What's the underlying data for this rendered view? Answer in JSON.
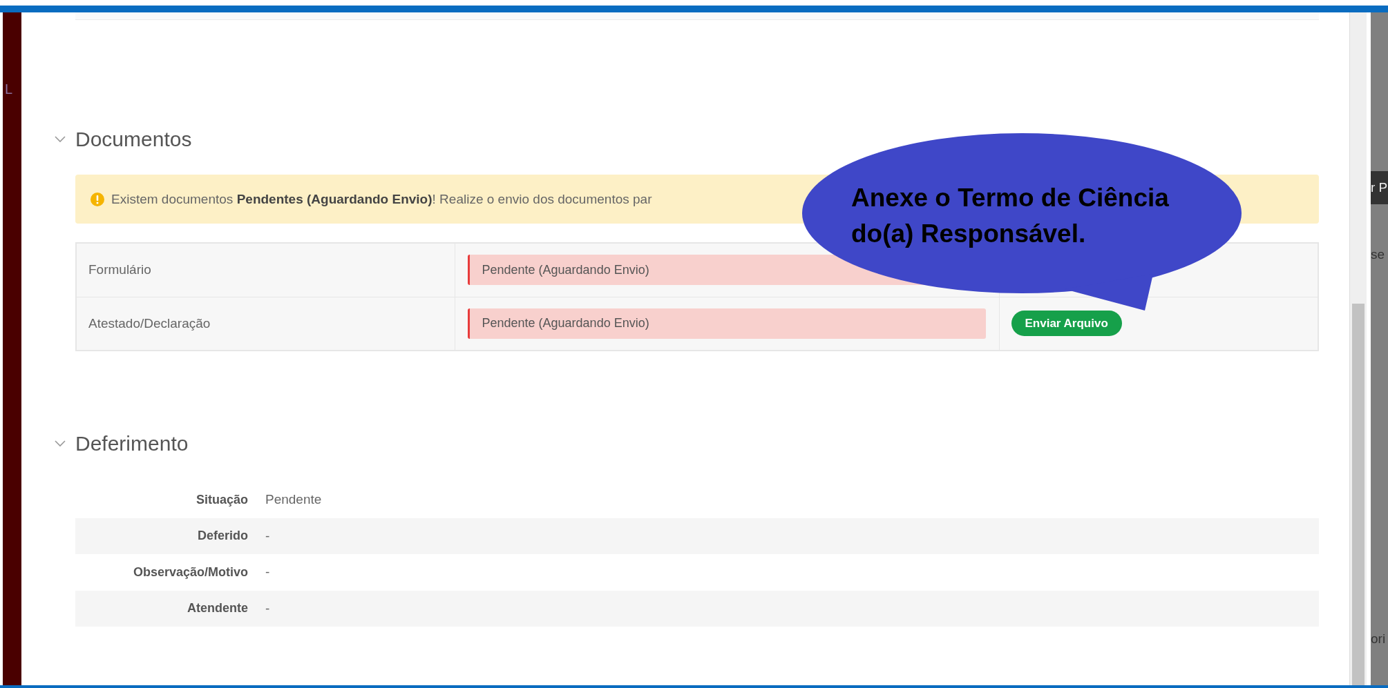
{
  "left_strip": {
    "label": "L"
  },
  "sections": [
    {
      "title": "Documentos",
      "expanded": true,
      "kind": "documents",
      "banner": {
        "text": "Existem documentos **Pendentes (Aguardando Envio)**! Realize o envio dos documentos par"
      },
      "rows": [
        {
          "name": "Formulário",
          "status": "Pendente (Aguardando Envio)",
          "kind": "pending"
        },
        {
          "name": "Atestado/Declaração",
          "status": "Pendente (Aguardando Envio)",
          "kind": "pending",
          "action": "Enviar Arquivo"
        }
      ]
    },
    {
      "title": "Deferimento",
      "expanded": true,
      "kind": "details",
      "fields": [
        {
          "label": "Situação",
          "value": "Pendente"
        },
        {
          "label": "Deferido",
          "value": "-"
        },
        {
          "label": "Observação/Motivo",
          "value": "-"
        },
        {
          "label": "Atendente",
          "value": "-"
        }
      ]
    }
  ],
  "callout": {
    "lines": [
      "Anexe o Termo de Ciência",
      "do(a) Responsável."
    ]
  },
  "background_fragments": [
    "r P",
    "se",
    "ori"
  ]
}
